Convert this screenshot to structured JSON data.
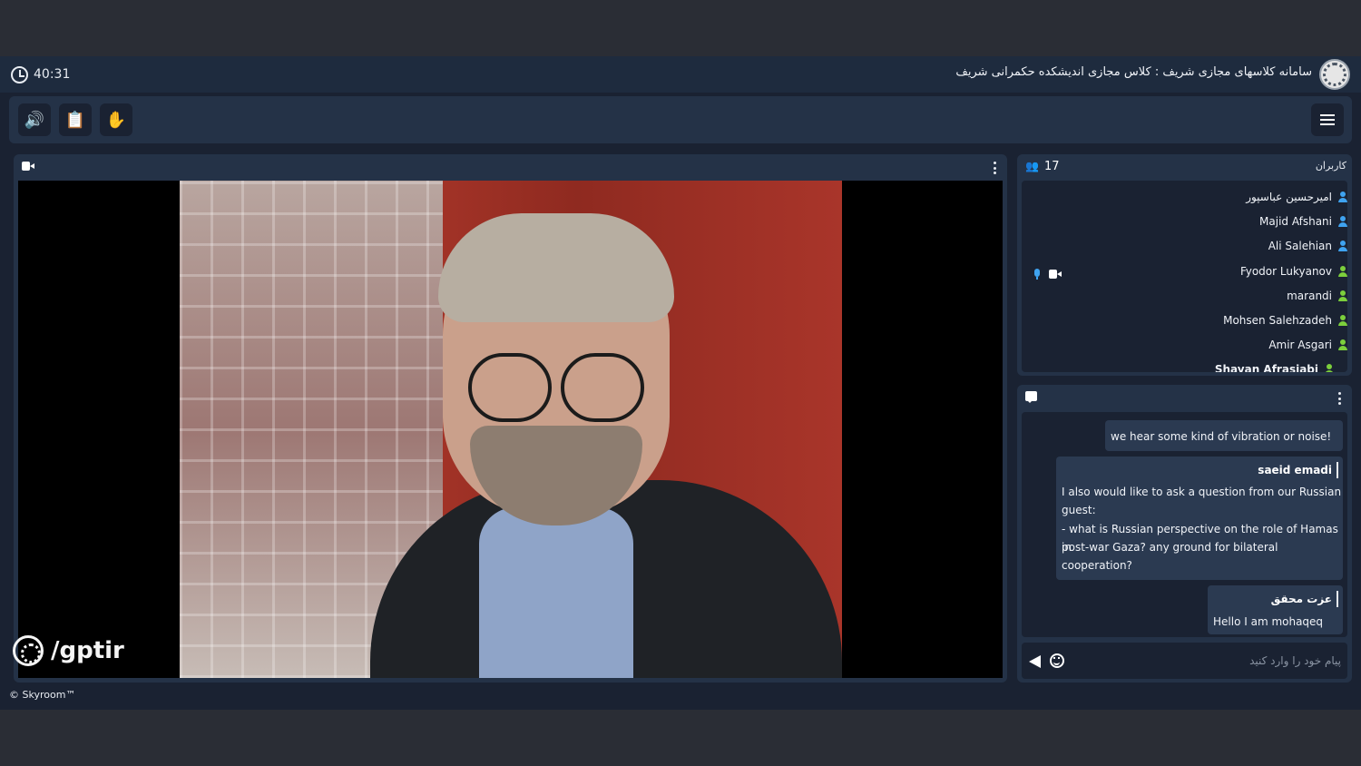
{
  "header": {
    "timer": "40:31",
    "title": "سامانه کلاسهای مجازی شریف : کلاس مجازی اندیشکده حکمرانی شریف"
  },
  "toolbar": {
    "speaker_icon": "🔊",
    "files_icon": "📋",
    "raise_hand_icon": "✋",
    "menu_icon": "hamburger-menu"
  },
  "video": {
    "watermark": "/gptir"
  },
  "users": {
    "title": "کاربران",
    "count": "17",
    "items": [
      {
        "name": "امیرحسین عباسپور",
        "role_color": "#3fa3f0"
      },
      {
        "name": "Majid Afshani",
        "role_color": "#3fa3f0"
      },
      {
        "name": "Ali Salehian",
        "role_color": "#3fa3f0"
      },
      {
        "name": "Fyodor Lukyanov",
        "role_color": "#7ccf3c"
      },
      {
        "name": "marandi",
        "role_color": "#7ccf3c"
      },
      {
        "name": "Mohsen Salehzadeh",
        "role_color": "#7ccf3c"
      },
      {
        "name": "Amir Asgari",
        "role_color": "#7ccf3c"
      },
      {
        "name": "Shayan Afrasiabi",
        "role_color": "#7ccf3c"
      }
    ]
  },
  "chat": {
    "messages": [
      {
        "author": "",
        "text": "we hear some kind of vibration or noise!"
      },
      {
        "author": "saeid emadi",
        "lines": [
          "I also would like to ask a question from our Russian",
          "guest:",
          "- what is Russian perspective on the role of Hamas in",
          "post-war Gaza? any ground for bilateral cooperation?"
        ]
      },
      {
        "author": "عزت محقق",
        "text": "Hello I am mohaqeq"
      }
    ],
    "input_placeholder": "پیام خود را وارد کنید"
  },
  "footer": {
    "brand": "© Skyroom™"
  },
  "colors": {
    "accent": "#3fc6e6",
    "panel": "#243247",
    "background": "#1a2232"
  }
}
